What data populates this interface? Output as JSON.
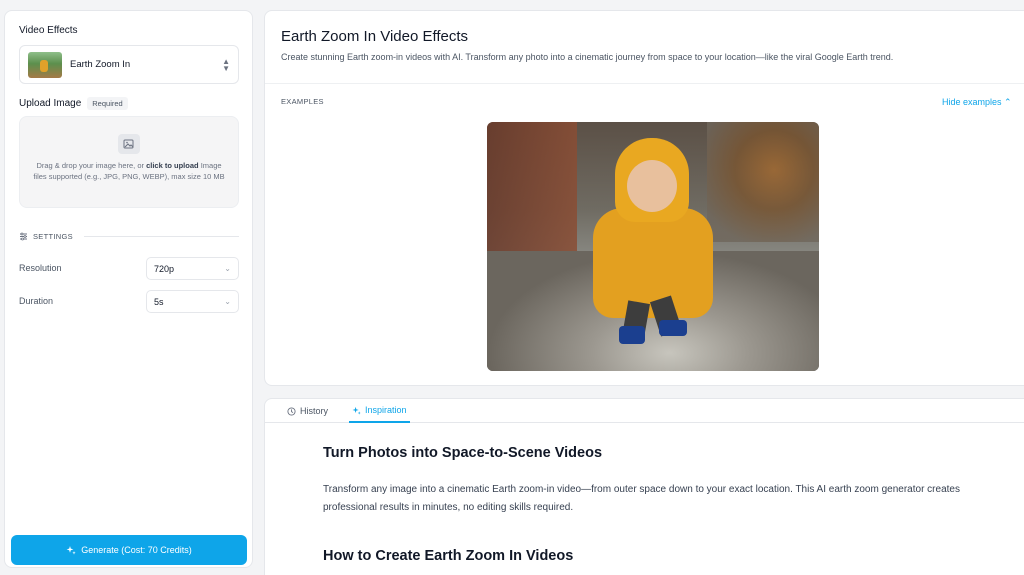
{
  "left_panel": {
    "video_effects_label": "Video Effects",
    "selected_effect": "Earth Zoom In",
    "upload_label": "Upload Image",
    "required_badge": "Required",
    "dropzone_text_prefix": "Drag & drop your image here, or",
    "dropzone_link": "click to upload",
    "dropzone_text_suffix": "Image files supported (e.g., JPG, PNG, WEBP), max size 10 MB",
    "settings_label": "SETTINGS",
    "resolution_label": "Resolution",
    "resolution_value": "720p",
    "duration_label": "Duration",
    "duration_value": "5s",
    "generate_button": "Generate (Cost: 70 Credits)"
  },
  "top_panel": {
    "title": "Earth Zoom In Video Effects",
    "description": "Create stunning Earth zoom-in videos with AI. Transform any photo into a cinematic journey from space to your location—like the viral Google Earth trend.",
    "examples_label": "EXAMPLES",
    "hide_examples": "Hide examples"
  },
  "bottom_panel": {
    "tabs": [
      {
        "label": "History",
        "icon": "clock-icon"
      },
      {
        "label": "Inspiration",
        "icon": "sparkles-icon"
      }
    ],
    "heading1": "Turn Photos into Space-to-Scene Videos",
    "paragraph": "Transform any image into a cinematic Earth zoom-in video—from outer space down to your exact location. This AI earth zoom generator creates professional results in minutes, no editing skills required.",
    "heading2": "How to Create Earth Zoom In Videos"
  },
  "colors": {
    "accent": "#0ea5e9",
    "text": "#111827"
  }
}
